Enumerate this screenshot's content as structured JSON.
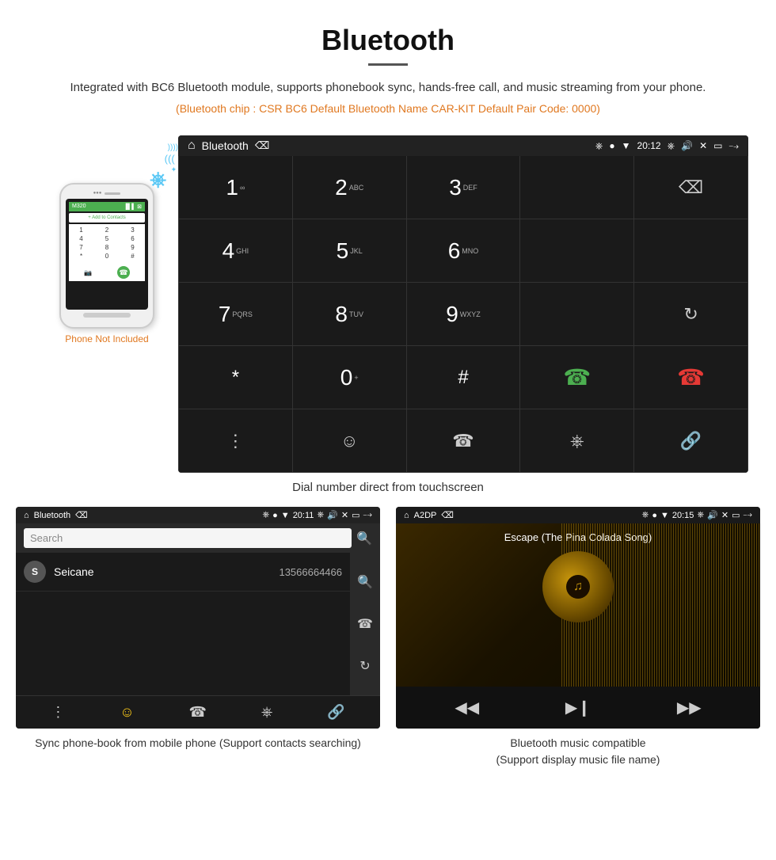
{
  "header": {
    "title": "Bluetooth",
    "description": "Integrated with BC6 Bluetooth module, supports phonebook sync, hands-free call, and music streaming from your phone.",
    "specs": "(Bluetooth chip : CSR BC6    Default Bluetooth Name CAR-KIT    Default Pair Code: 0000)"
  },
  "phone_mockup": {
    "add_contacts": "+ Add to Contacts",
    "numpad": [
      "1",
      "2",
      "3",
      "4",
      "5",
      "6",
      "7",
      "8",
      "9",
      "*",
      "0",
      "#"
    ],
    "not_included": "Phone Not Included"
  },
  "car_screen": {
    "status_bar": {
      "title": "Bluetooth",
      "time": "20:12"
    },
    "numpad": [
      {
        "num": "1",
        "sub": "∞"
      },
      {
        "num": "2",
        "sub": "ABC"
      },
      {
        "num": "3",
        "sub": "DEF"
      },
      {
        "num": "4",
        "sub": "GHI"
      },
      {
        "num": "5",
        "sub": "JKL"
      },
      {
        "num": "6",
        "sub": "MNO"
      },
      {
        "num": "7",
        "sub": "PQRS"
      },
      {
        "num": "8",
        "sub": "TUV"
      },
      {
        "num": "9",
        "sub": "WXYZ"
      },
      {
        "num": "*",
        "sub": ""
      },
      {
        "num": "0",
        "sub": "+"
      },
      {
        "num": "#",
        "sub": ""
      }
    ],
    "dial_caption": "Dial number direct from touchscreen"
  },
  "phonebook_screen": {
    "status": {
      "title": "Bluetooth",
      "time": "20:11"
    },
    "search_placeholder": "Search",
    "contact": {
      "initial": "S",
      "name": "Seicane",
      "number": "13566664466"
    },
    "caption": "Sync phone-book from mobile phone\n(Support contacts searching)"
  },
  "music_screen": {
    "status": {
      "title": "A2DP",
      "time": "20:15"
    },
    "song_title": "Escape (The Pina Colada Song)",
    "caption": "Bluetooth music compatible\n(Support display music file name)"
  }
}
